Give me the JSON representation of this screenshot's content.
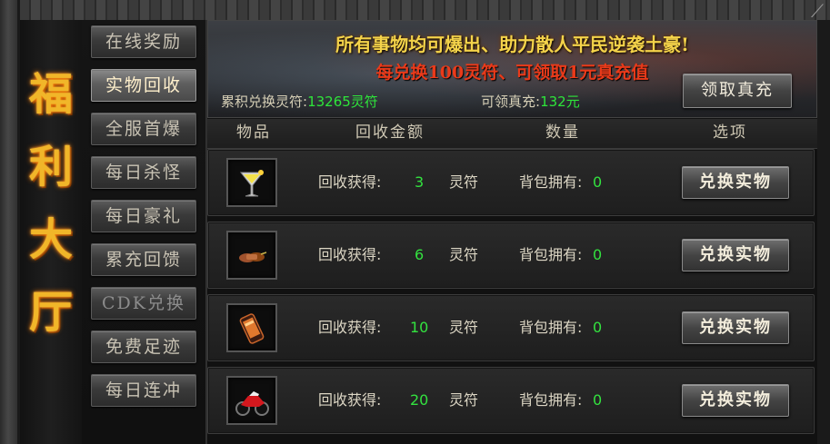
{
  "title": {
    "chars": [
      "福",
      "利",
      "大",
      "厅"
    ]
  },
  "nav": {
    "items": [
      {
        "label": "在线奖励"
      },
      {
        "label": "实物回收"
      },
      {
        "label": "全服首爆"
      },
      {
        "label": "每日杀怪"
      },
      {
        "label": "每日豪礼"
      },
      {
        "label": "累充回馈"
      },
      {
        "label": "CDK兑换"
      },
      {
        "label": "免费足迹"
      },
      {
        "label": "每日连冲"
      }
    ],
    "active": "实物回收"
  },
  "banner": {
    "line1": "所有事物均可爆出、助力散人平民逆袭土豪!",
    "line2": "每兑换100灵符、可领取1元真充值",
    "total_label": "累积兑换灵符:",
    "total_value": "13265灵符",
    "claimable_label": "可领真充:",
    "claimable_value": "132元",
    "claim_button": "领取真充"
  },
  "table": {
    "headers": [
      "物品",
      "回收金额",
      "数量",
      "选项"
    ],
    "rows": [
      {
        "item_icon": "cocktail-glass-icon",
        "reward_label": "回收获得:",
        "reward_value": "3",
        "unit": "灵符",
        "owned_label": "背包拥有:",
        "owned_value": "0",
        "button": "兑换实物"
      },
      {
        "item_icon": "handshake-icon",
        "reward_label": "回收获得:",
        "reward_value": "6",
        "unit": "灵符",
        "owned_label": "背包拥有:",
        "owned_value": "0",
        "button": "兑换实物"
      },
      {
        "item_icon": "smartphone-icon",
        "reward_label": "回收获得:",
        "reward_value": "10",
        "unit": "灵符",
        "owned_label": "背包拥有:",
        "owned_value": "0",
        "button": "兑换实物"
      },
      {
        "item_icon": "motorcycle-icon",
        "reward_label": "回收获得:",
        "reward_value": "20",
        "unit": "灵符",
        "owned_label": "背包拥有:",
        "owned_value": "0",
        "button": "兑换实物"
      }
    ]
  },
  "colors": {
    "accent_gold": "#f1b629",
    "value_green": "#33e23f",
    "banner_red": "#e93a1a",
    "banner_yellow": "#f4d34a"
  }
}
